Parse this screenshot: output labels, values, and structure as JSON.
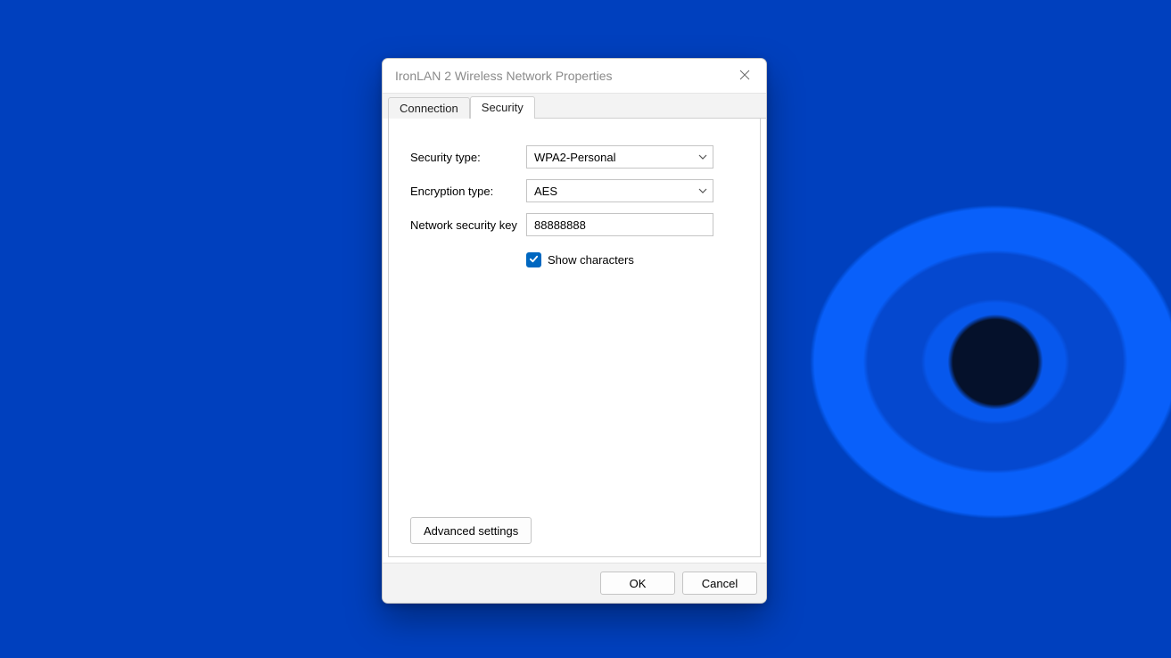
{
  "window": {
    "title": "IronLAN 2 Wireless Network Properties"
  },
  "tabs": {
    "connection": "Connection",
    "security": "Security",
    "active": "security"
  },
  "form": {
    "security_type_label": "Security type:",
    "security_type_value": "WPA2-Personal",
    "encryption_type_label": "Encryption type:",
    "encryption_type_value": "AES",
    "network_key_label": "Network security key",
    "network_key_value": "88888888",
    "show_characters_label": "Show characters",
    "show_characters_checked": true,
    "advanced_label": "Advanced settings"
  },
  "footer": {
    "ok": "OK",
    "cancel": "Cancel"
  },
  "colors": {
    "accent": "#0067c0"
  }
}
